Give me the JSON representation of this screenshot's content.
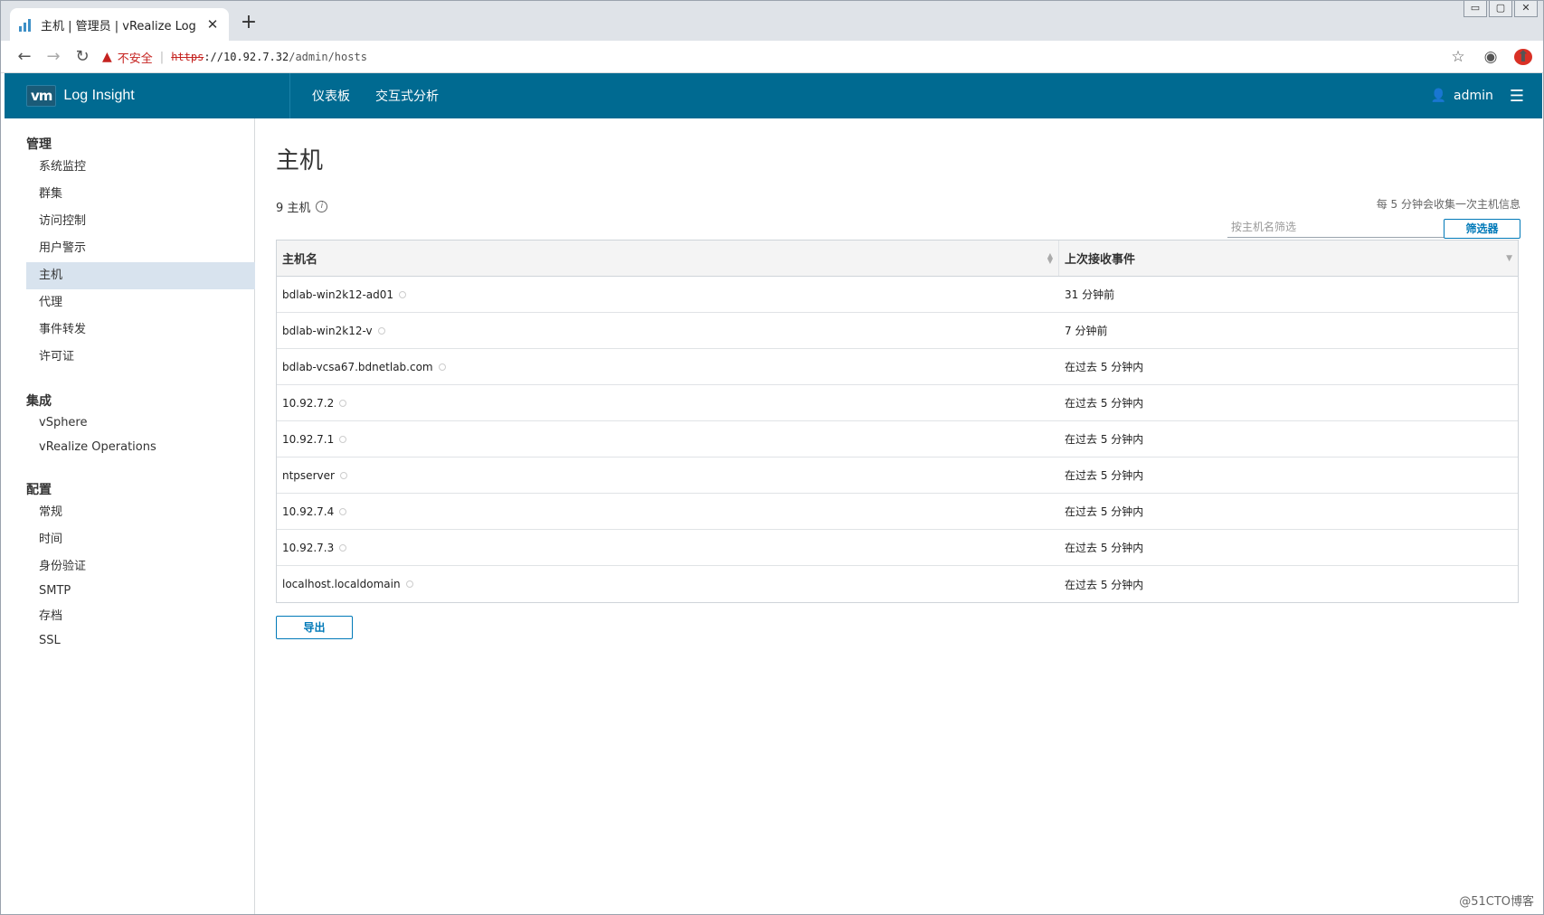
{
  "browser": {
    "tab_title": "主机 | 管理员 | vRealize Log",
    "tab_close": "✕",
    "new_tab": "+",
    "security_label": "不安全",
    "url_scheme": "https",
    "url_rest_host": "://10.92.7.32",
    "url_path": "/admin/hosts",
    "window_controls": [
      "▭",
      "▢",
      "✕"
    ]
  },
  "header": {
    "logo_text": "vm",
    "app_name": "Log Insight",
    "nav": [
      "仪表板",
      "交互式分析"
    ],
    "user": "admin"
  },
  "sidebar": {
    "sections": [
      {
        "title": "管理",
        "items": [
          "系统监控",
          "群集",
          "访问控制",
          "用户警示",
          "主机",
          "代理",
          "事件转发",
          "许可证"
        ]
      },
      {
        "title": "集成",
        "items": [
          "vSphere",
          "vRealize Operations"
        ]
      },
      {
        "title": "配置",
        "items": [
          "常规",
          "时间",
          "身份验证",
          "SMTP",
          "存档",
          "SSL"
        ]
      }
    ],
    "active_item": "主机"
  },
  "main": {
    "title": "主机",
    "count_label": "9 主机",
    "interval_note": "每 5 分钟会收集一次主机信息",
    "filter_placeholder": "按主机名筛选",
    "filter_button": "筛选器",
    "columns": [
      "主机名",
      "上次接收事件"
    ],
    "rows": [
      {
        "host": "bdlab-win2k12-ad01",
        "last": "31 分钟前"
      },
      {
        "host": "bdlab-win2k12-v",
        "last": "7 分钟前"
      },
      {
        "host": "bdlab-vcsa67.bdnetlab.com",
        "last": "在过去 5 分钟内"
      },
      {
        "host": "10.92.7.2",
        "last": "在过去 5 分钟内"
      },
      {
        "host": "10.92.7.1",
        "last": "在过去 5 分钟内"
      },
      {
        "host": "ntpserver",
        "last": "在过去 5 分钟内"
      },
      {
        "host": "10.92.7.4",
        "last": "在过去 5 分钟内"
      },
      {
        "host": "10.92.7.3",
        "last": "在过去 5 分钟内"
      },
      {
        "host": "localhost.localdomain",
        "last": "在过去 5 分钟内"
      }
    ],
    "export_button": "导出"
  },
  "watermark": "@51CTO博客",
  "colors": {
    "header_bg": "#006a91",
    "accent": "#0079b8",
    "active_bg": "#d8e3ee"
  }
}
